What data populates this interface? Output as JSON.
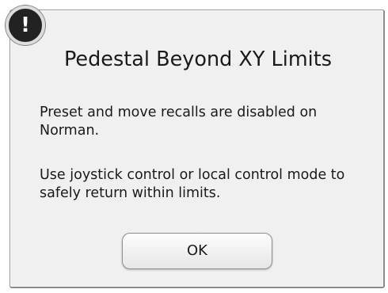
{
  "dialog": {
    "icon": "exclamation-icon",
    "icon_glyph": "!",
    "title": "Pedestal Beyond XY Limits",
    "message_line1": "Preset and move recalls are disabled on Norman.",
    "message_line2": "Use joystick control or local control mode to safely return within limits.",
    "ok_label": "OK"
  },
  "colors": {
    "badge": "#222222",
    "dialog_bg": "#f0f0f0"
  }
}
